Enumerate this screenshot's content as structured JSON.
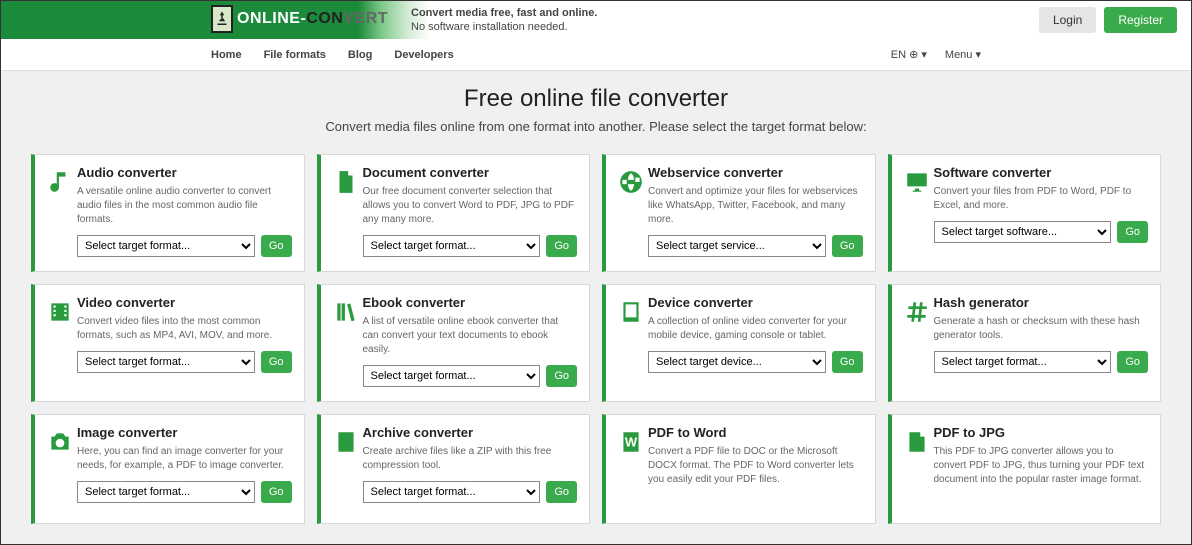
{
  "header": {
    "logo_pre": "ONLINE-",
    "logo_mid": "CON",
    "logo_post": "VERT",
    "tagline_bold": "Convert media free, fast and online.",
    "tagline_sub": "No software installation needed.",
    "login": "Login",
    "register": "Register"
  },
  "nav": {
    "items": [
      "Home",
      "File formats",
      "Blog",
      "Developers"
    ],
    "lang": "EN ⊕ ▾",
    "menu": "Menu ▾"
  },
  "hero": {
    "title": "Free online file converter",
    "subtitle": "Convert media files online from one format into another. Please select the target format below:"
  },
  "go_label": "Go",
  "cards": [
    {
      "title": "Audio converter",
      "desc": "A versatile online audio converter to convert audio files in the most common audio file formats.",
      "select": "Select target format...",
      "has_select": true,
      "icon": "music-icon"
    },
    {
      "title": "Document converter",
      "desc": "Our free document converter selection that allows you to convert Word to PDF, JPG to PDF any many more.",
      "select": "Select target format...",
      "has_select": true,
      "icon": "document-icon"
    },
    {
      "title": "Webservice converter",
      "desc": "Convert and optimize your files for webservices like WhatsApp, Twitter, Facebook, and many more.",
      "select": "Select target service...",
      "has_select": true,
      "icon": "globe-icon"
    },
    {
      "title": "Software converter",
      "desc": "Convert your files from PDF to Word, PDF to Excel, and more.",
      "select": "Select target software...",
      "has_select": true,
      "icon": "monitor-icon"
    },
    {
      "title": "Video converter",
      "desc": "Convert video files into the most common formats, such as MP4, AVI, MOV, and more.",
      "select": "Select target format...",
      "has_select": true,
      "icon": "film-icon"
    },
    {
      "title": "Ebook converter",
      "desc": "A list of versatile online ebook converter that can convert your text documents to ebook easily.",
      "select": "Select target format...",
      "has_select": true,
      "icon": "books-icon"
    },
    {
      "title": "Device converter",
      "desc": "A collection of online video converter for your mobile device, gaming console or tablet.",
      "select": "Select target device...",
      "has_select": true,
      "icon": "tablet-icon"
    },
    {
      "title": "Hash generator",
      "desc": "Generate a hash or checksum with these hash generator tools.",
      "select": "Select target format...",
      "has_select": true,
      "icon": "hash-icon"
    },
    {
      "title": "Image converter",
      "desc": "Here, you can find an image converter for your needs, for example, a PDF to image converter.",
      "select": "Select target format...",
      "has_select": true,
      "icon": "camera-icon"
    },
    {
      "title": "Archive converter",
      "desc": "Create archive files like a ZIP with this free compression tool.",
      "select": "Select target format...",
      "has_select": true,
      "icon": "archive-icon"
    },
    {
      "title": "PDF to Word",
      "desc": "Convert a PDF file to DOC or the Microsoft DOCX format. The PDF to Word converter lets you easily edit your PDF files.",
      "has_select": false,
      "icon": "word-icon"
    },
    {
      "title": "PDF to JPG",
      "desc": "This PDF to JPG converter allows you to convert PDF to JPG, thus turning your PDF text document into the popular raster image format.",
      "has_select": false,
      "icon": "jpg-icon"
    }
  ]
}
